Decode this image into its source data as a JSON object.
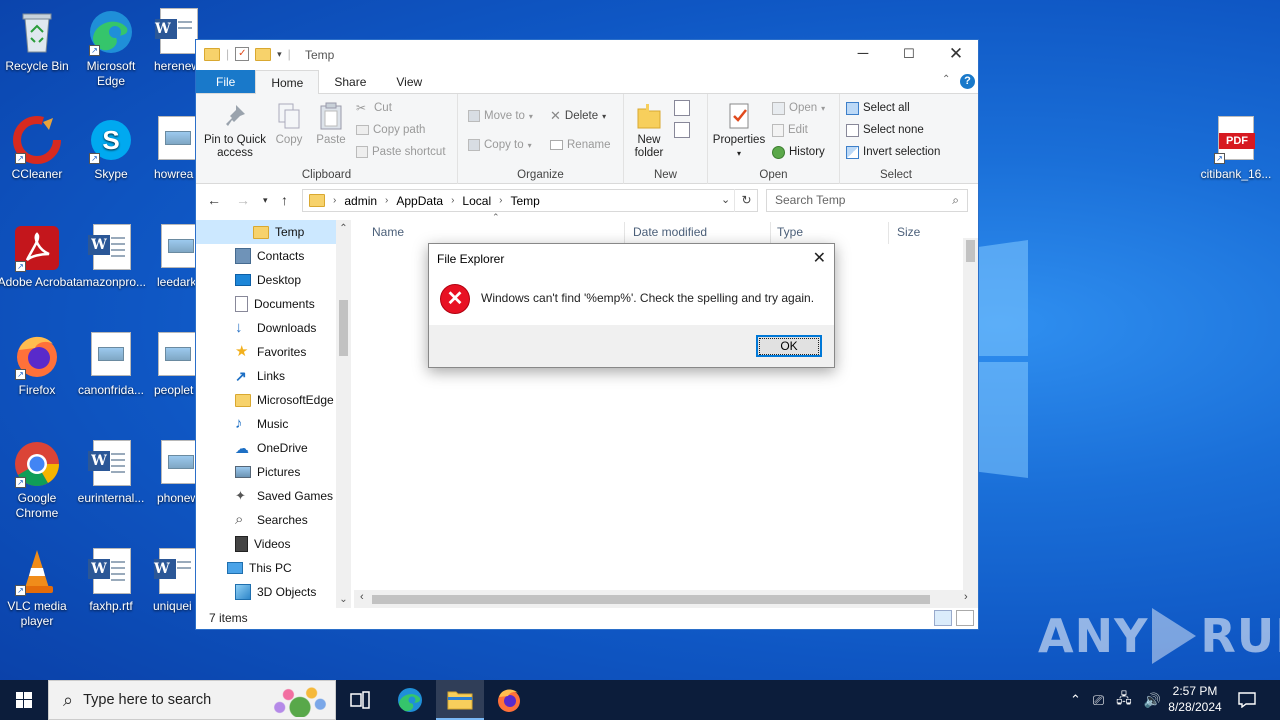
{
  "desktop": {
    "icons": [
      {
        "label": "Recycle Bin"
      },
      {
        "label": "Microsoft Edge"
      },
      {
        "label": "herenew"
      },
      {
        "label": "CCleaner"
      },
      {
        "label": "Skype"
      },
      {
        "label": "howrea"
      },
      {
        "label": "Adobe Acrobat"
      },
      {
        "label": "amazonpro..."
      },
      {
        "label": "leedark"
      },
      {
        "label": "Firefox"
      },
      {
        "label": "canonfrida..."
      },
      {
        "label": "peoplet"
      },
      {
        "label": "Google Chrome"
      },
      {
        "label": "eurinternal..."
      },
      {
        "label": "phonew"
      },
      {
        "label": "VLC media player"
      },
      {
        "label": "faxhp.rtf"
      },
      {
        "label": "uniquei"
      },
      {
        "label": "citibank_16..."
      }
    ]
  },
  "explorer": {
    "title": "Temp",
    "tabs": [
      "File",
      "Home",
      "Share",
      "View"
    ],
    "ribbon": {
      "clipboard": {
        "label": "Clipboard",
        "pin": "Pin to Quick access",
        "copy": "Copy",
        "paste": "Paste",
        "cut": "Cut",
        "copy_path": "Copy path",
        "paste_shortcut": "Paste shortcut"
      },
      "organize": {
        "label": "Organize",
        "move_to": "Move to",
        "copy_to": "Copy to",
        "delete": "Delete",
        "rename": "Rename"
      },
      "new": {
        "label": "New",
        "new_folder": "New folder"
      },
      "open": {
        "label": "Open",
        "properties": "Properties",
        "open": "Open",
        "edit": "Edit",
        "history": "History"
      },
      "select": {
        "label": "Select",
        "select_all": "Select all",
        "select_none": "Select none",
        "invert": "Invert selection"
      }
    },
    "address": {
      "crumbs": [
        "admin",
        "AppData",
        "Local",
        "Temp"
      ]
    },
    "search": {
      "placeholder": "Search Temp"
    },
    "nav": [
      "Temp",
      "Contacts",
      "Desktop",
      "Documents",
      "Downloads",
      "Favorites",
      "Links",
      "MicrosoftEdge",
      "Music",
      "OneDrive",
      "Pictures",
      "Saved Games",
      "Searches",
      "Videos",
      "This PC",
      "3D Objects"
    ],
    "columns": [
      "Name",
      "Date modified",
      "Type",
      "Size"
    ],
    "status": "7 items"
  },
  "dialog": {
    "title": "File Explorer",
    "message": "Windows can't find '%emp%'. Check the spelling and try again.",
    "ok": "OK"
  },
  "taskbar": {
    "search_placeholder": "Type here to search",
    "time": "2:57 PM",
    "date": "8/28/2024"
  },
  "watermark": {
    "left": "ANY",
    "right": "RUN"
  }
}
